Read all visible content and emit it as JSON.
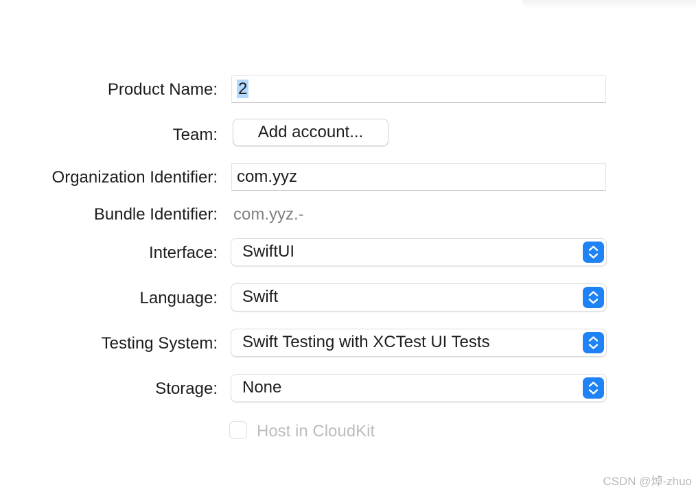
{
  "form": {
    "product_name": {
      "label": "Product Name:",
      "value": "2"
    },
    "team": {
      "label": "Team:",
      "button_label": "Add account..."
    },
    "organization_identifier": {
      "label": "Organization Identifier:",
      "value": "com.yyz"
    },
    "bundle_identifier": {
      "label": "Bundle Identifier:",
      "value": "com.yyz.-"
    },
    "interface": {
      "label": "Interface:",
      "selected": "SwiftUI"
    },
    "language": {
      "label": "Language:",
      "selected": "Swift"
    },
    "testing_system": {
      "label": "Testing System:",
      "selected": "Swift Testing with XCTest UI Tests"
    },
    "storage": {
      "label": "Storage:",
      "selected": "None"
    },
    "host_in_cloudkit": {
      "label": "Host in CloudKit",
      "checked": false,
      "enabled": false
    }
  },
  "watermark": "CSDN @焯-zhuo",
  "colors": {
    "accent": "#1f82f5",
    "selection": "#b3d7ff",
    "disabled_text": "#bdbdbd",
    "secondary_text": "#808080"
  },
  "icons": {
    "popup_indicator": "chevron-up-down-icon"
  }
}
